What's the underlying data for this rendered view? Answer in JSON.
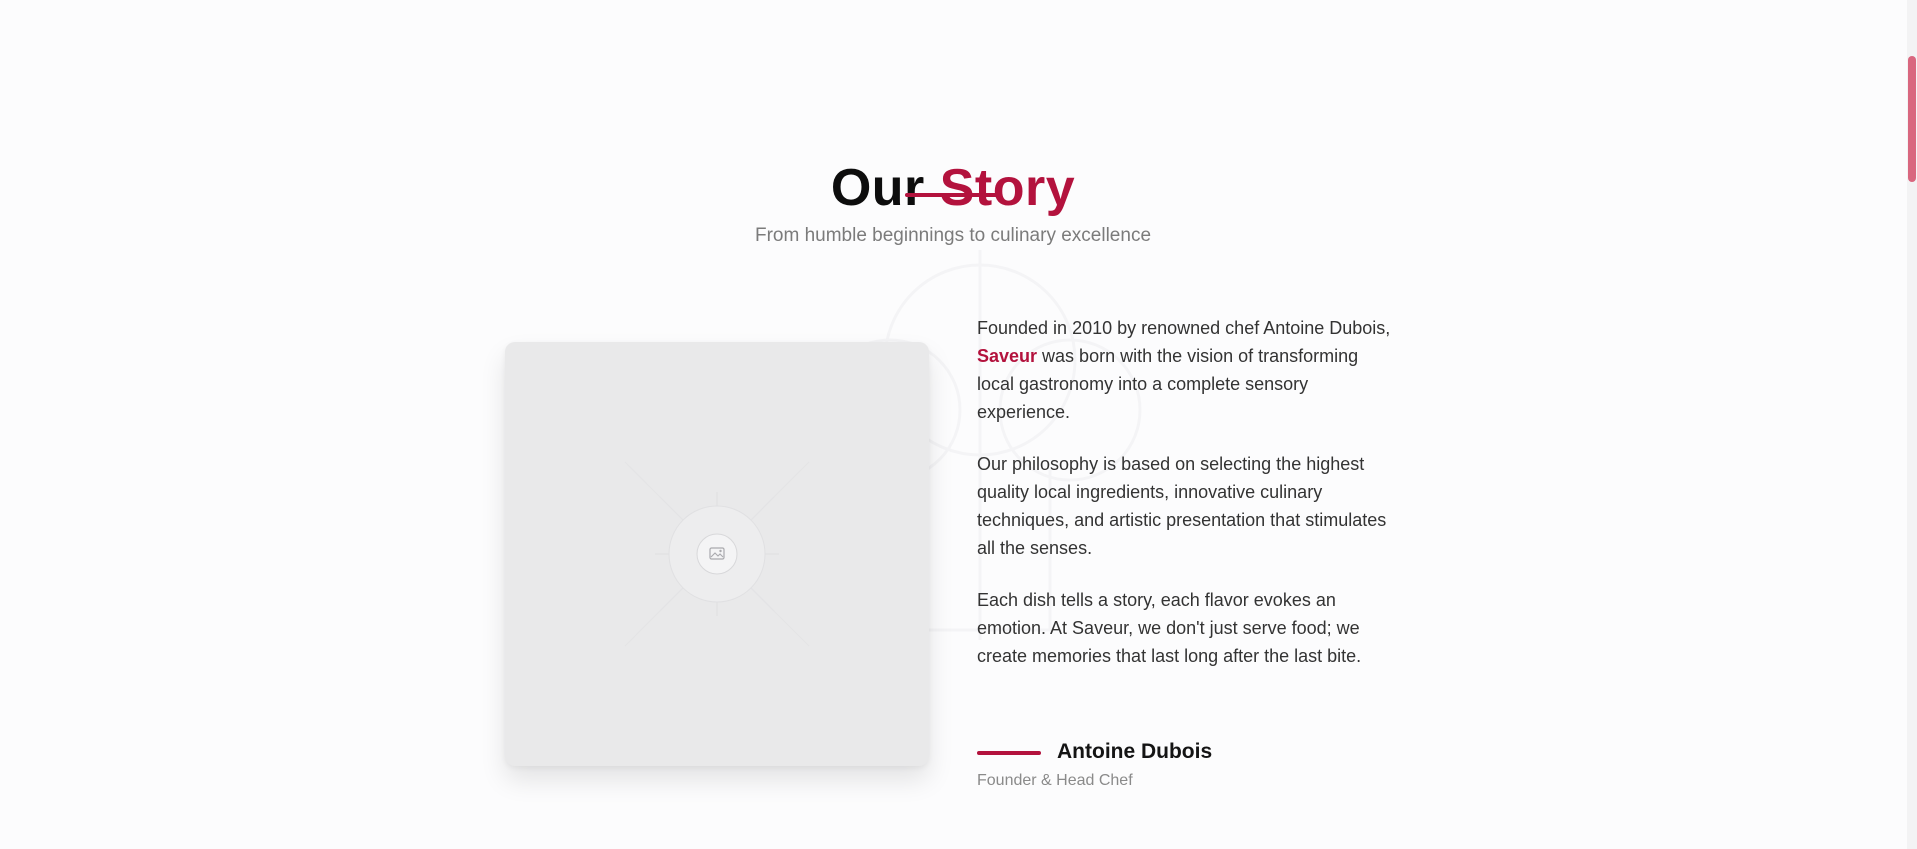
{
  "section": {
    "title_main": "Our",
    "title_accent": "Story",
    "subtitle": "From humble beginnings to culinary excellence"
  },
  "image": {
    "placeholder_icon": "image-icon"
  },
  "story": {
    "p1_before": "Founded in 2010 by renowned chef Antoine Dubois, ",
    "brand": "Saveur",
    "p1_after": " was born with the vision of transforming local gastronomy into a complete sensory experience.",
    "p2": "Our philosophy is based on selecting the highest quality local ingredients, innovative culinary techniques, and artistic presentation that stimulates all the senses.",
    "p3": "Each dish tells a story, each flavor evokes an emotion. At Saveur, we don't just serve food; we create memories that last long after the last bite."
  },
  "signature": {
    "name": "Antoine Dubois",
    "role": "Founder & Head Chef"
  },
  "colors": {
    "accent": "#b3123d",
    "background": "#fcfcfd",
    "image_placeholder": "#e9e9ea"
  }
}
